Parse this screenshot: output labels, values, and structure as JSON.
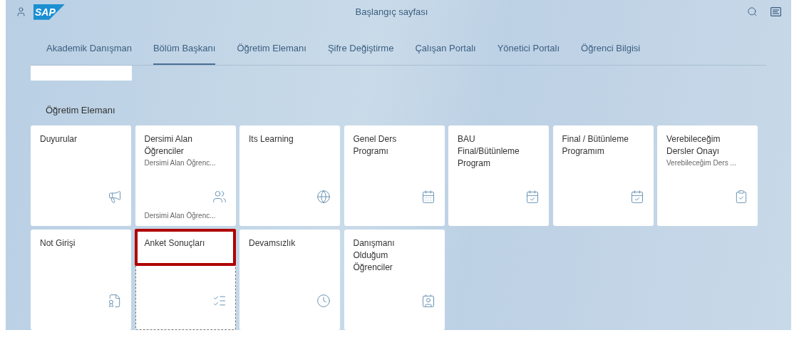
{
  "header": {
    "logo": "SAP",
    "title": "Başlangıç sayfası"
  },
  "tabs": [
    {
      "label": "Akademik Danışman",
      "selected": false
    },
    {
      "label": "Bölüm Başkanı",
      "selected": true
    },
    {
      "label": "Öğretim Elemanı",
      "selected": false
    },
    {
      "label": "Şifre Değiştirme",
      "selected": false
    },
    {
      "label": "Çalışan Portalı",
      "selected": false
    },
    {
      "label": "Yönetici Portalı",
      "selected": false
    },
    {
      "label": "Öğrenci Bilgisi",
      "selected": false
    }
  ],
  "section": {
    "title": "Öğretim Elemanı"
  },
  "tiles": [
    {
      "title": "Duyurular",
      "kind": "megaphone",
      "highlighted": false
    },
    {
      "title": "Dersimi Alan Öğrenciler",
      "subtitle": "Dersimi Alan Öğrenc...",
      "footer": "Dersimi Alan Öğrenc...",
      "kind": "people",
      "highlighted": false
    },
    {
      "title": "Its Learning",
      "kind": "web",
      "highlighted": false
    },
    {
      "title": "Genel Ders Programı",
      "kind": "calendar",
      "highlighted": false
    },
    {
      "title": "BAU Final/Bütünleme Program",
      "kind": "calendar-event",
      "highlighted": false
    },
    {
      "title": "Final / Bütünleme Programım",
      "kind": "calendar-event",
      "highlighted": false
    },
    {
      "title": "Verebileceğim Dersler Onayı",
      "subtitle": "Verebileceğim Ders ...",
      "kind": "approval",
      "highlighted": false
    },
    {
      "title": "Not Girişi",
      "kind": "grade",
      "highlighted": false
    },
    {
      "title": "Anket Sonuçları",
      "kind": "checklist",
      "highlighted": true
    },
    {
      "title": "Devamsızlık",
      "kind": "clock",
      "highlighted": false
    },
    {
      "title": "Danışmanı Olduğum Öğrenciler",
      "kind": "contacts",
      "highlighted": false
    }
  ]
}
